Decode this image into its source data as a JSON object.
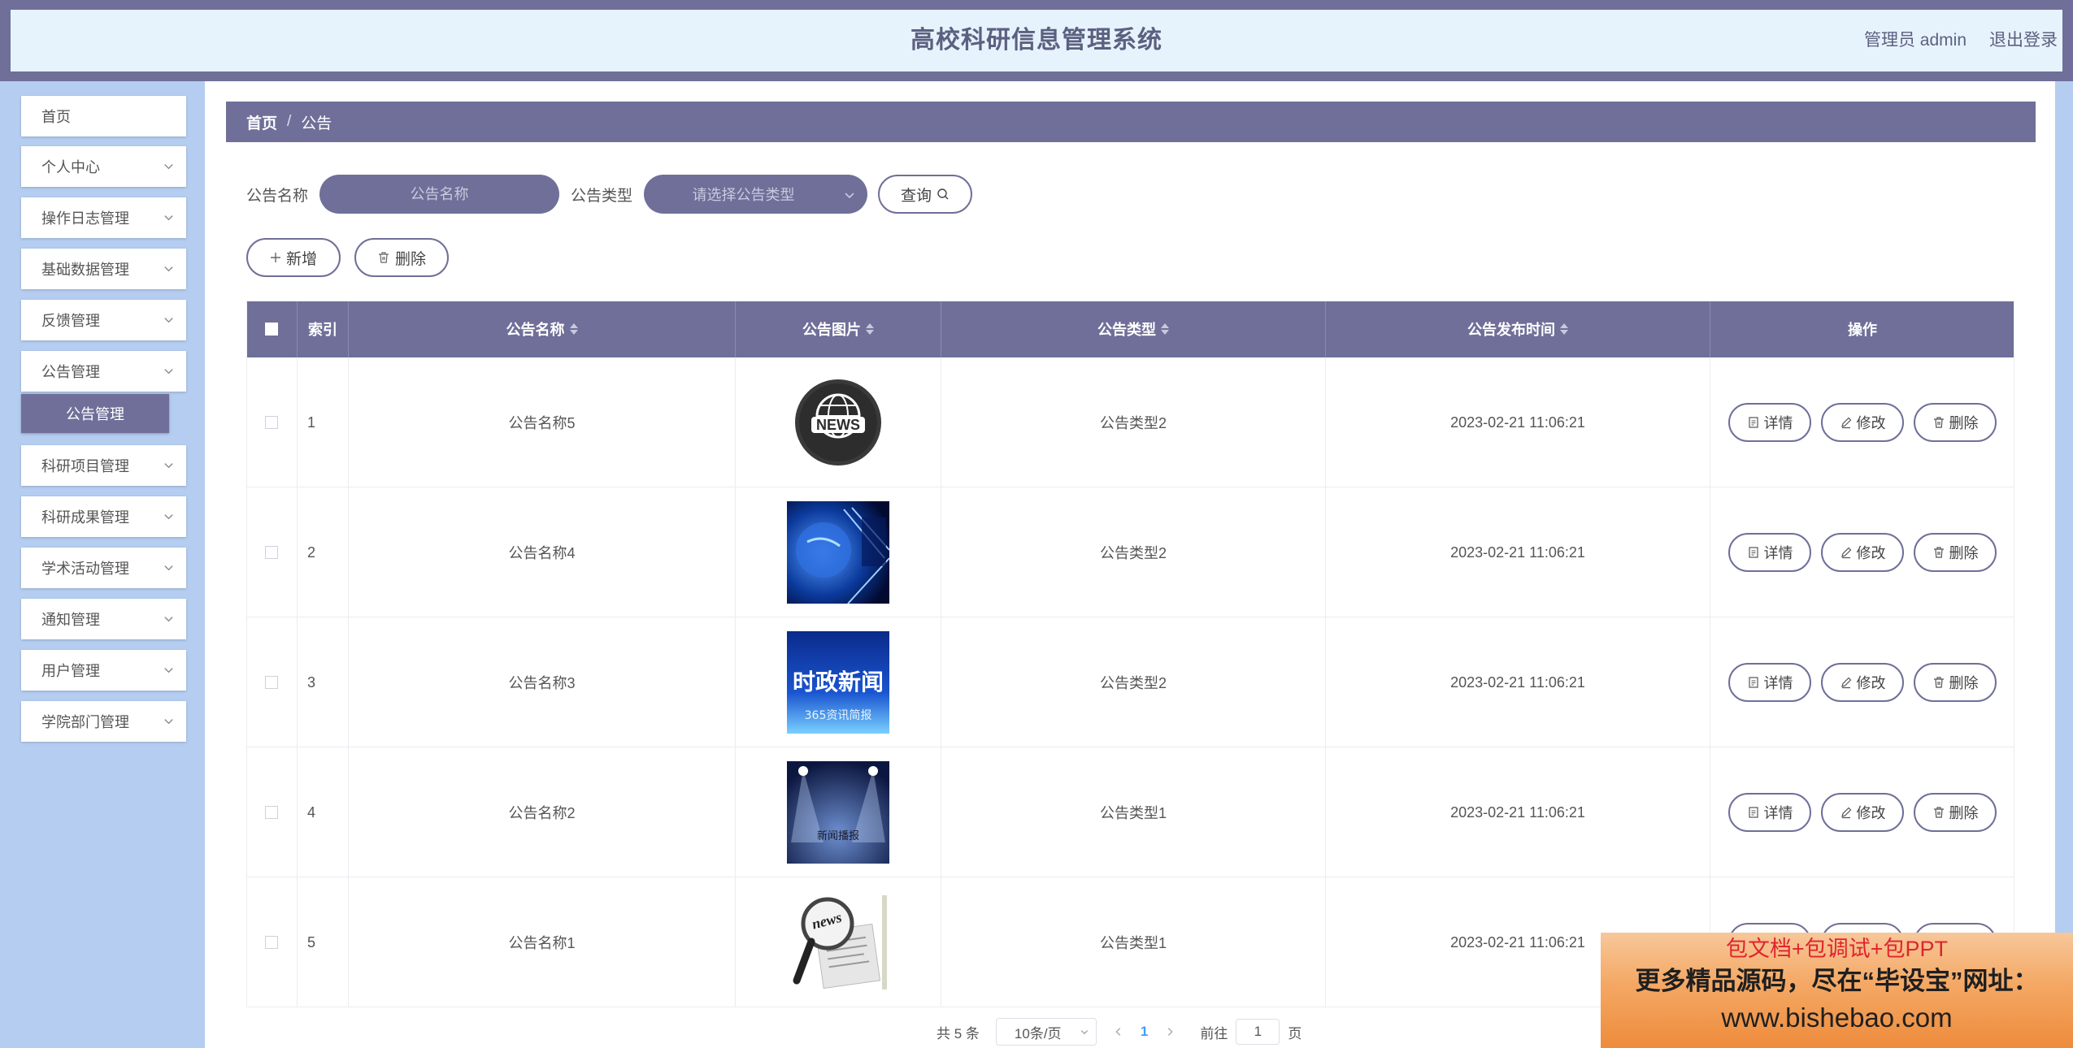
{
  "header": {
    "title": "高校科研信息管理系统",
    "admin_label": "管理员 admin",
    "logout_label": "退出登录"
  },
  "sidebar": {
    "items": [
      {
        "label": "首页",
        "has_chevron": false
      },
      {
        "label": "个人中心",
        "has_chevron": true
      },
      {
        "label": "操作日志管理",
        "has_chevron": true
      },
      {
        "label": "基础数据管理",
        "has_chevron": true
      },
      {
        "label": "反馈管理",
        "has_chevron": true
      },
      {
        "label": "公告管理",
        "has_chevron": true
      },
      {
        "label": "科研项目管理",
        "has_chevron": true
      },
      {
        "label": "科研成果管理",
        "has_chevron": true
      },
      {
        "label": "学术活动管理",
        "has_chevron": true
      },
      {
        "label": "通知管理",
        "has_chevron": true
      },
      {
        "label": "用户管理",
        "has_chevron": true
      },
      {
        "label": "学院部门管理",
        "has_chevron": true
      }
    ],
    "active_sub": "公告管理"
  },
  "breadcrumb": {
    "home": "首页",
    "separator": "/",
    "current": "公告"
  },
  "search": {
    "name_label": "公告名称",
    "name_placeholder": "公告名称",
    "type_label": "公告类型",
    "type_placeholder": "请选择公告类型",
    "query_label": "查询"
  },
  "actions": {
    "add_label": "新增",
    "delete_label": "删除"
  },
  "table": {
    "headers": {
      "index": "索引",
      "name": "公告名称",
      "image": "公告图片",
      "type": "公告类型",
      "time": "公告发布时间",
      "ops": "操作"
    },
    "rows": [
      {
        "index": "1",
        "name": "公告名称5",
        "image": "news-globe-badge",
        "type": "公告类型2",
        "time": "2023-02-21 11:06:21"
      },
      {
        "index": "2",
        "name": "公告名称4",
        "image": "blue-globe-tech",
        "type": "公告类型2",
        "time": "2023-02-21 11:06:21"
      },
      {
        "index": "3",
        "name": "公告名称3",
        "image": "political-news-banner",
        "type": "公告类型2",
        "time": "2023-02-21 11:06:21"
      },
      {
        "index": "4",
        "name": "公告名称2",
        "image": "stage-spotlights",
        "type": "公告类型1",
        "time": "2023-02-21 11:06:21"
      },
      {
        "index": "5",
        "name": "公告名称1",
        "image": "magnifier-newspaper",
        "type": "公告类型1",
        "time": "2023-02-21 11:06:21"
      }
    ],
    "op_labels": {
      "detail": "详情",
      "edit": "修改",
      "delete": "删除"
    }
  },
  "thumb_text": {
    "news_badge": "NEWS",
    "political_big": "时政新闻",
    "political_small": "365资讯简报",
    "stage_caption": "新闻播报",
    "magnifier_word": "news"
  },
  "pagination": {
    "total": "共 5 条",
    "page_size": "10条/页",
    "current_page": "1",
    "goto_label": "前往",
    "goto_value": "1",
    "page_unit": "页"
  },
  "promo": {
    "line1": "包文档+包调试+包PPT",
    "line2": "更多精品源码，尽在“毕设宝”网址：",
    "line3": "www.bishebao.com"
  },
  "colors": {
    "primary": "#6f6f99",
    "sidebar_bg": "#b4cdf0",
    "header_bg": "#e7f3fc",
    "link_blue": "#409eff"
  }
}
